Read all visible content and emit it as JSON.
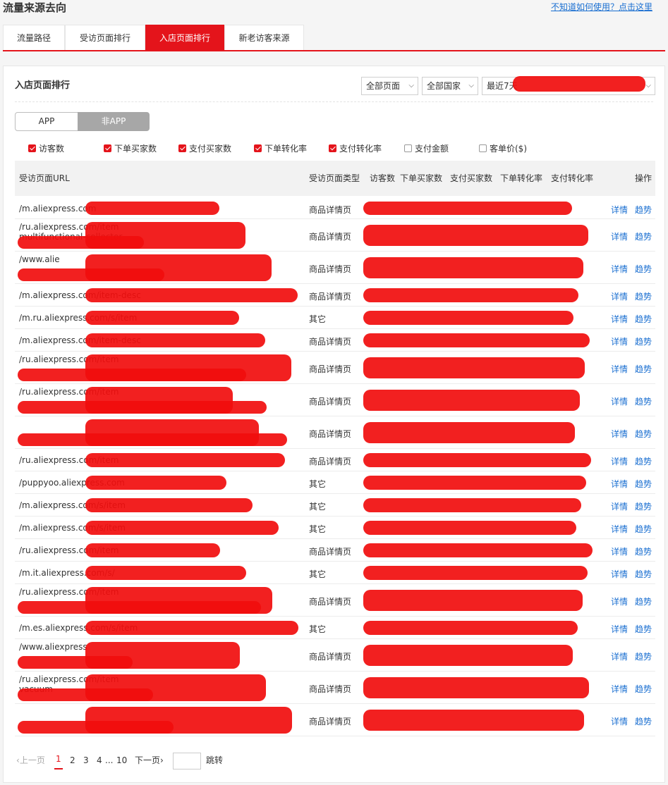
{
  "header": {
    "title": "流量来源去向",
    "help_link": "不知道如何使用？点击这里"
  },
  "tabs": [
    {
      "label": "流量路径",
      "active": false
    },
    {
      "label": "受访页面排行",
      "active": false
    },
    {
      "label": "入店页面排行",
      "active": true
    },
    {
      "label": "新老访客来源",
      "active": false
    }
  ],
  "panel": {
    "title": "入店页面排行",
    "filters": {
      "page": "全部页面",
      "country": "全部国家",
      "range": "最近7天"
    },
    "segment": {
      "app": "APP",
      "non_app": "非APP",
      "selected": "非APP"
    },
    "metrics": [
      {
        "label": "访客数",
        "checked": true
      },
      {
        "label": "下单买家数",
        "checked": true
      },
      {
        "label": "支付买家数",
        "checked": true
      },
      {
        "label": "下单转化率",
        "checked": true
      },
      {
        "label": "支付转化率",
        "checked": true
      },
      {
        "label": "支付金额",
        "checked": false
      },
      {
        "label": "客单价($)",
        "checked": false
      }
    ]
  },
  "table": {
    "columns": {
      "url": "受访页面URL",
      "type": "受访页面类型",
      "visitors": "访客数",
      "order_buyers": "下单买家数",
      "pay_buyers": "支付买家数",
      "order_rate": "下单转化率",
      "pay_rate": "支付转化率",
      "ops": "操作"
    },
    "detail_label": "详情",
    "trend_label": "趋势",
    "rows": [
      {
        "url1": "/m.aliexpress.com",
        "url2": "",
        "type": "商品详情页"
      },
      {
        "url1": "/ru.aliexpress.com/item",
        "url2": "multifunctional-collector",
        "type": "商品详情页"
      },
      {
        "url1": "/www.alie",
        "url2": "",
        "type": "商品详情页"
      },
      {
        "url1": "/m.aliexpress.com/item-desc",
        "url2": "",
        "type": "商品详情页"
      },
      {
        "url1": "/m.ru.aliexpress.com/s/item",
        "url2": "",
        "type": "其它"
      },
      {
        "url1": "/m.aliexpress.com/item-desc",
        "url2": "",
        "type": "商品详情页"
      },
      {
        "url1": "/ru.aliexpress.com/item",
        "url2": "",
        "type": "商品详情页"
      },
      {
        "url1": "/ru.aliexpress.com/item",
        "url2": "",
        "type": "商品详情页"
      },
      {
        "url1": "",
        "url2": "",
        "type": "商品详情页"
      },
      {
        "url1": "/ru.aliexpress.com/item",
        "url2": "",
        "type": "商品详情页"
      },
      {
        "url1": "/puppyoo.aliexpress.com",
        "url2": "",
        "type": "其它"
      },
      {
        "url1": "/m.aliexpress.com/s/item",
        "url2": "",
        "type": "其它"
      },
      {
        "url1": "/m.aliexpress.com/s/item",
        "url2": "",
        "type": "其它"
      },
      {
        "url1": "/ru.aliexpress.com/item",
        "url2": "",
        "type": "商品详情页"
      },
      {
        "url1": "/m.it.aliexpress.com/s/",
        "url2": "",
        "type": "其它"
      },
      {
        "url1": "/ru.aliexpress.com/item",
        "url2": "",
        "type": "商品详情页"
      },
      {
        "url1": "/m.es.aliexpress.com/s/item",
        "url2": "",
        "type": "其它"
      },
      {
        "url1": "/www.aliexpress",
        "url2": "",
        "type": "商品详情页"
      },
      {
        "url1": "/ru.aliexpress.com/item",
        "url2": "vacuum",
        "type": "商品详情页"
      },
      {
        "url1": "",
        "url2": "",
        "type": "商品详情页"
      }
    ]
  },
  "pagination": {
    "prev": "上一页",
    "pages": [
      "1",
      "2",
      "3",
      "4"
    ],
    "ellipsis": "...",
    "last": "10",
    "next": "下一页",
    "jump": "跳转",
    "current": "1"
  },
  "colors": {
    "accent": "#e4141b",
    "link": "#1a6fd1",
    "redaction": "#f10d0d"
  }
}
